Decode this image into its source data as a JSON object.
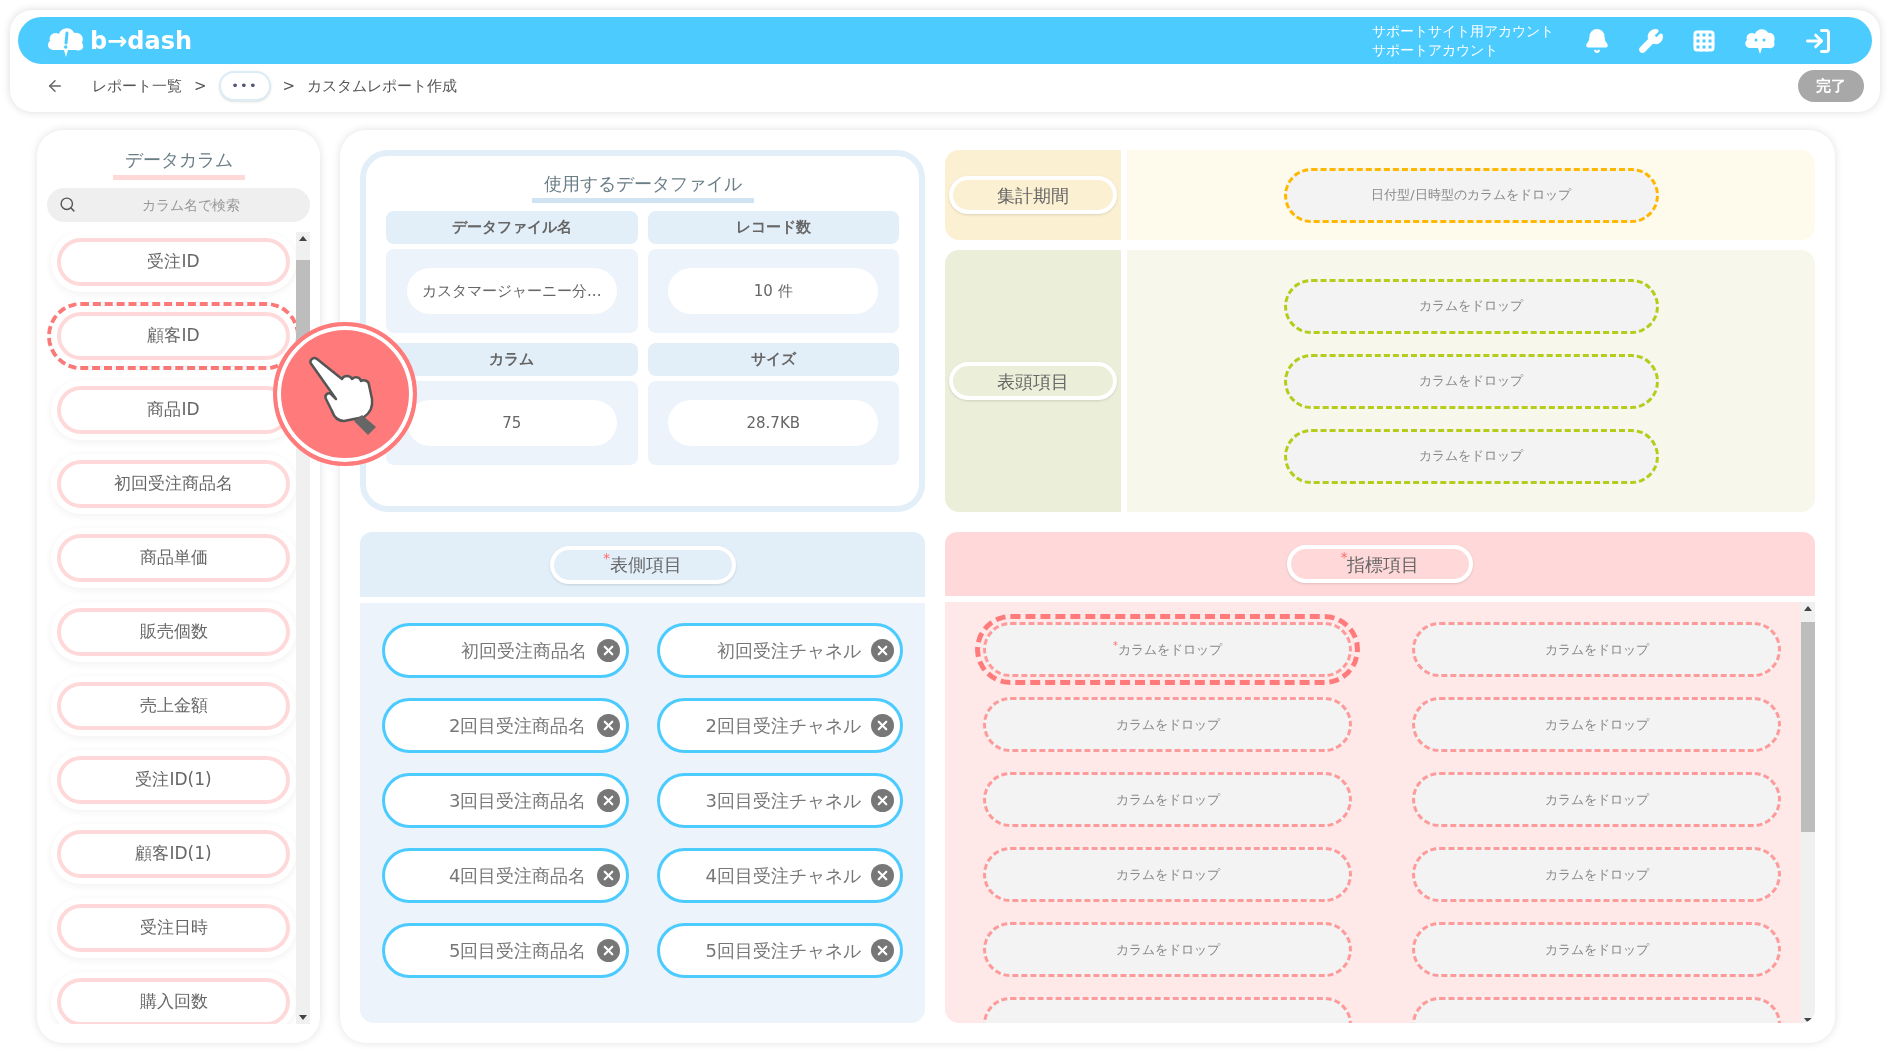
{
  "header": {
    "logo": "b→dash",
    "account_lines": [
      "サポートサイト用アカウント",
      "サポートアカウント"
    ]
  },
  "breadcrumb": [
    {
      "kind": "link",
      "label": "レポート一覧"
    },
    {
      "kind": "separator",
      "label": ">"
    },
    {
      "kind": "ellipsis",
      "label": "•••"
    },
    {
      "kind": "separator",
      "label": ">"
    },
    {
      "kind": "current",
      "label": "カスタムレポート作成"
    }
  ],
  "done_button": {
    "label": "完了",
    "disabled": true
  },
  "sidebar": {
    "title": "データカラム",
    "search": {
      "placeholder": "カラム名で検索"
    },
    "items": [
      {
        "label": "受注ID",
        "selected": false
      },
      {
        "label": "顧客ID",
        "selected": true
      },
      {
        "label": "商品ID",
        "selected": false
      },
      {
        "label": "初回受注商品名",
        "selected": false
      },
      {
        "label": "商品単価",
        "selected": false
      },
      {
        "label": "販売個数",
        "selected": false
      },
      {
        "label": "売上金額",
        "selected": false
      },
      {
        "label": "受注ID(1)",
        "selected": false
      },
      {
        "label": "顧客ID(1)",
        "selected": false
      },
      {
        "label": "受注日時",
        "selected": false
      },
      {
        "label": "購入回数",
        "selected": false
      }
    ]
  },
  "file_info": {
    "title": "使用するデータファイル",
    "fields": [
      {
        "label": "データファイル名",
        "value": "カスタマージャーニー分..."
      },
      {
        "label": "レコード数",
        "value": "10 件"
      },
      {
        "label": "カラム",
        "value": "75"
      },
      {
        "label": "サイズ",
        "value": "28.7KB"
      }
    ]
  },
  "period": {
    "label": "集計期間",
    "slots": [
      "日付型/日時型のカラムをドロップ"
    ]
  },
  "header_items": {
    "label": "表頭項目",
    "slots": [
      "カラムをドロップ",
      "カラムをドロップ",
      "カラムをドロップ"
    ]
  },
  "row_items": {
    "label": "$^{*}$表側項目",
    "chips": [
      "初回受注商品名",
      "初回受注チャネル",
      "2回目受注商品名",
      "2回目受注チャネル",
      "3回目受注商品名",
      "3回目受注チャネル",
      "4回目受注商品名",
      "4回目受注チャネル",
      "5回目受注商品名",
      "5回目受注チャネル"
    ]
  },
  "metrics": {
    "label": "$^{*}$指標項目",
    "slots": [
      {
        "kind": "slot",
        "label": "$^{*}$カラムをドロップ",
        "selected": true
      },
      {
        "kind": "slot",
        "label": "カラムをドロップ",
        "selected": false
      },
      {
        "kind": "slot",
        "label": "カラムをドロップ",
        "selected": false
      },
      {
        "kind": "slot",
        "label": "カラムをドロップ",
        "selected": false
      },
      {
        "kind": "slot",
        "label": "カラムをドロップ",
        "selected": false
      },
      {
        "kind": "slot",
        "label": "カラムをドロップ",
        "selected": false
      },
      {
        "kind": "slot",
        "label": "カラムをドロップ",
        "selected": false
      },
      {
        "kind": "slot",
        "label": "カラムをドロップ",
        "selected": false
      },
      {
        "kind": "slot",
        "label": "カラムをドロップ",
        "selected": false
      },
      {
        "kind": "slot",
        "label": "カラムをドロップ",
        "selected": false
      },
      {
        "kind": "clipped",
        "selected": false
      },
      {
        "kind": "clipped",
        "selected": false
      }
    ]
  }
}
